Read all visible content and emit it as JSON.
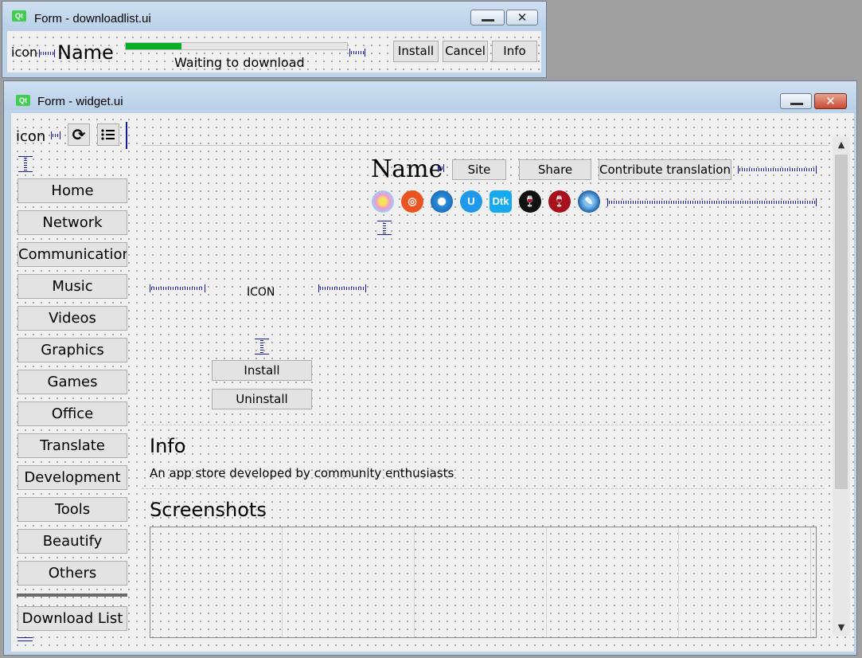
{
  "download_window": {
    "title": "Form - downloadlist.ui",
    "icon_label": "icon",
    "name_label": "Name",
    "status": "Waiting to download",
    "progress": 0.25,
    "buttons": {
      "install": "Install",
      "cancel": "Cancel",
      "info": "Info"
    }
  },
  "widget_window": {
    "title": "Form - widget.ui",
    "sidebar": {
      "icon_label": "icon",
      "items": [
        "Home",
        "Network",
        "Communication",
        "Music",
        "Videos",
        "Graphics",
        "Games",
        "Office",
        "Translate",
        "Development",
        "Tools",
        "Beautify",
        "Others"
      ],
      "download_list": "Download List"
    },
    "app": {
      "name": "Name",
      "site": "Site",
      "share": "Share",
      "contribute": "Contribute translation",
      "icon_placeholder": "ICON",
      "install": "Install",
      "uninstall": "Uninstall"
    },
    "distro_icons": [
      "rainbow-swirl-icon",
      "ubuntu-icon",
      "deepin-icon",
      "uos-icon",
      "dtk-icon",
      "wine-icon",
      "wine-red-icon",
      "debug-tool-icon"
    ],
    "info": {
      "heading": "Info",
      "text": "An app store developed by community enthusiasts"
    },
    "screenshots": {
      "heading": "Screenshots"
    },
    "colors": {
      "accent_progress": "#06b025",
      "spacer": "#1a1aa0"
    }
  }
}
